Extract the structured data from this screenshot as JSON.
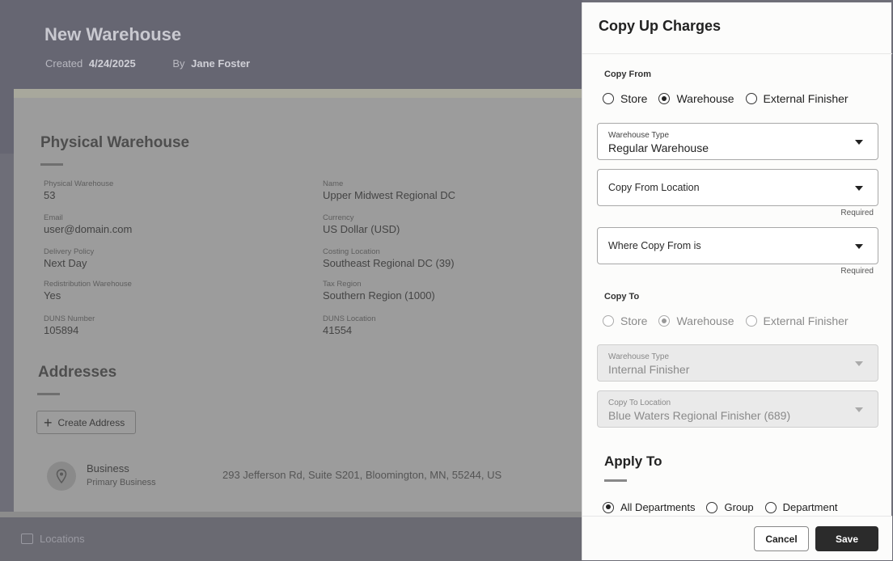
{
  "background": {
    "title": "New Warehouse",
    "created_label": "Created",
    "created_date": "4/24/2025",
    "by_label": "By",
    "by_name": "Jane Foster",
    "physical_section_title": "Physical Warehouse",
    "fields": {
      "physical_warehouse": {
        "label": "Physical Warehouse",
        "value": "53"
      },
      "name": {
        "label": "Name",
        "value": "Upper Midwest Regional DC"
      },
      "email": {
        "label": "Email",
        "value": "user@domain.com"
      },
      "currency": {
        "label": "Currency",
        "value": "US Dollar (USD)"
      },
      "delivery_policy": {
        "label": "Delivery Policy",
        "value": "Next Day"
      },
      "costing_location": {
        "label": "Costing Location",
        "value": "Southeast Regional DC (39)"
      },
      "redistribution_warehouse": {
        "label": "Redistribution Warehouse",
        "value": "Yes"
      },
      "tax_region": {
        "label": "Tax Region",
        "value": "Southern Region (1000)"
      },
      "duns_number": {
        "label": "DUNS Number",
        "value": "105894"
      },
      "duns_location": {
        "label": "DUNS Location",
        "value": "41554"
      }
    },
    "addresses_section_title": "Addresses",
    "create_address_label": "Create Address",
    "address": {
      "type": "Business",
      "subtype": "Primary Business",
      "line": "293 Jefferson Rd, Suite S201, Bloomington, MN, 55244, US"
    },
    "footer_locations_label": "Locations"
  },
  "drawer": {
    "title": "Copy Up Charges",
    "copy_from": {
      "label": "Copy From",
      "options": [
        "Store",
        "Warehouse",
        "External Finisher"
      ],
      "selected": "Warehouse"
    },
    "warehouse_type_from": {
      "label": "Warehouse Type",
      "value": "Regular Warehouse"
    },
    "copy_from_location": {
      "placeholder": "Copy From Location",
      "required": "Required"
    },
    "where_copy_from": {
      "placeholder": "Where Copy From is",
      "required": "Required"
    },
    "copy_to": {
      "label": "Copy To",
      "options": [
        "Store",
        "Warehouse",
        "External Finisher"
      ],
      "selected": "Warehouse"
    },
    "warehouse_type_to": {
      "label": "Warehouse Type",
      "value": "Internal Finisher"
    },
    "copy_to_location": {
      "label": "Copy To Location",
      "value": "Blue Waters Regional Finisher (689)"
    },
    "apply_to": {
      "title": "Apply To",
      "options": [
        "All Departments",
        "Group",
        "Department"
      ],
      "selected": "All Departments"
    },
    "cancel_label": "Cancel",
    "save_label": "Save"
  }
}
